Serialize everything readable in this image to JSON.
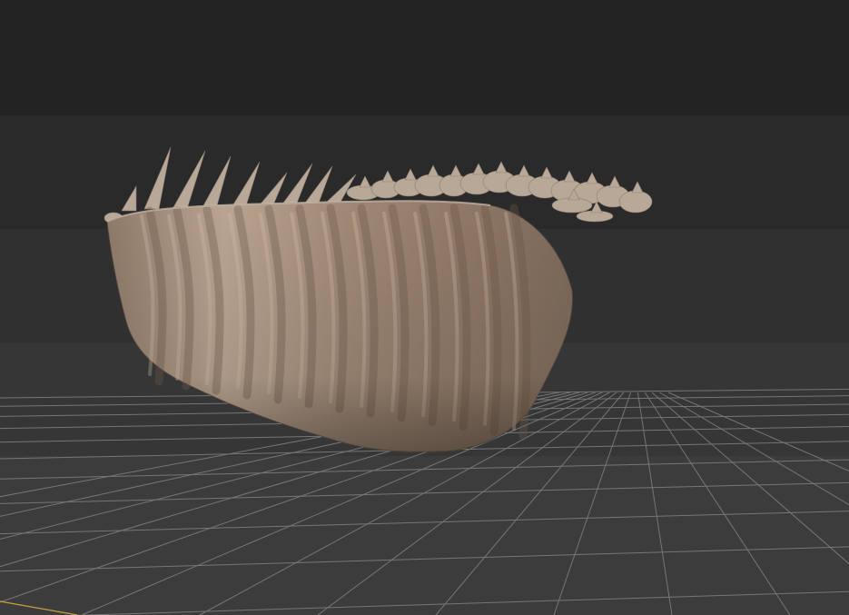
{
  "viewport": {
    "background_bands": [
      "#232323",
      "#2a2a2a",
      "#303030",
      "#363636",
      "#3c3c3c"
    ],
    "grid_color": "#8a8a8a",
    "axis_x_color": "#c8a040",
    "model": {
      "name": "ribcage-with-spine",
      "shade_base": "#9a8472",
      "shade_light": "#c9b8a6",
      "shade_dark": "#6f5c4e",
      "vertebra_color": "#b8a898"
    }
  }
}
